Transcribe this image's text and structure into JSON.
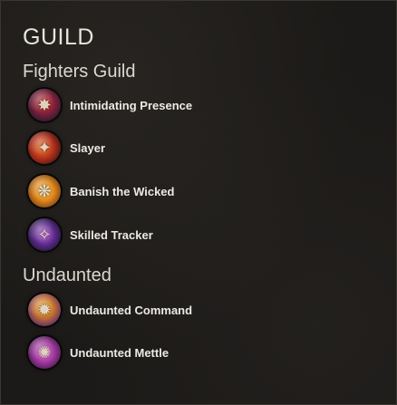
{
  "panel": {
    "title": "GUILD"
  },
  "groups": [
    {
      "name": "Fighters Guild",
      "skills": [
        {
          "label": "Intimidating Presence",
          "icon": "intimidating-presence-icon"
        },
        {
          "label": "Slayer",
          "icon": "slayer-icon"
        },
        {
          "label": "Banish the Wicked",
          "icon": "banish-the-wicked-icon"
        },
        {
          "label": "Skilled Tracker",
          "icon": "skilled-tracker-icon"
        }
      ]
    },
    {
      "name": "Undaunted",
      "skills": [
        {
          "label": "Undaunted Command",
          "icon": "undaunted-command-icon"
        },
        {
          "label": "Undaunted Mettle",
          "icon": "undaunted-mettle-icon"
        }
      ]
    }
  ],
  "colors": {
    "background": "#1c1a18",
    "text": "#eceae4"
  }
}
